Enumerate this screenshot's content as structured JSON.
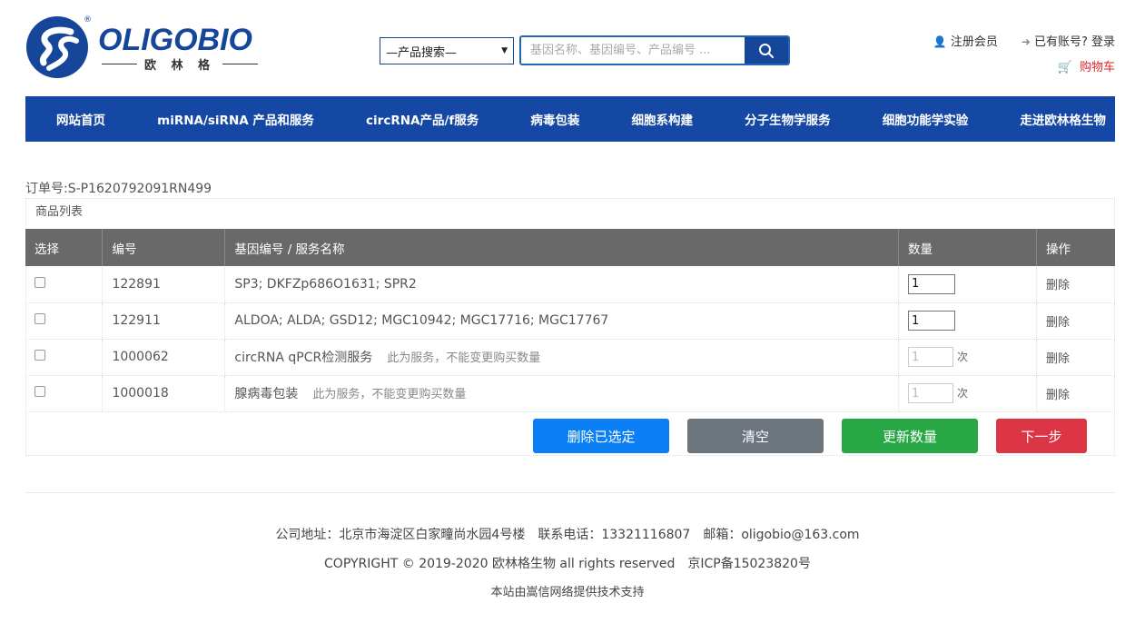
{
  "brand": {
    "name": "OLIGOBIO",
    "reg_mark": "®",
    "subtitle": "欧 林 格",
    "primary_color": "#15469a"
  },
  "search": {
    "category_selected": "—产品搜索—",
    "placeholder": "基因名称、基因编号、产品编号 ...",
    "icon": "search-icon"
  },
  "toplinks": {
    "register": "注册会员",
    "login": "已有账号? 登录",
    "cart": "购物车"
  },
  "nav": {
    "items": [
      "网站首页",
      "miRNA/siRNA 产品和服务",
      "circRNA产品/f服务",
      "病毒包装",
      "细胞系构建",
      "分子生物学服务",
      "细胞功能学实验",
      "走进欧林格生物"
    ]
  },
  "order": {
    "order_no": "订单号:S-P1620792091RN499",
    "list_title": "商品列表",
    "columns": [
      "选择",
      "编号",
      "基因编号 / 服务名称",
      "数量",
      "操作"
    ],
    "rows": [
      {
        "id": "122891",
        "name": "SP3; DKFZp686O1631; SPR2",
        "note": "",
        "qty": "1",
        "unit": "",
        "action": "删除"
      },
      {
        "id": "122911",
        "name": "ALDOA; ALDA; GSD12; MGC10942; MGC17716; MGC17767",
        "note": "",
        "qty": "1",
        "unit": "",
        "action": "删除"
      },
      {
        "id": "1000062",
        "name": "circRNA qPCR检测服务",
        "note": "此为服务，不能变更购买数量",
        "qty": "1",
        "unit": "次",
        "action": "删除"
      },
      {
        "id": "1000018",
        "name": "腺病毒包装",
        "note": "此为服务，不能变更购买数量",
        "qty": "1",
        "unit": "次",
        "action": "删除"
      }
    ],
    "buttons": {
      "delete_selected": "删除已选定",
      "clear": "清空",
      "update_qty": "更新数量",
      "next": "下一步"
    }
  },
  "footer": {
    "line1": "公司地址：北京市海淀区白家疃尚水园4号楼　联系电话：13321116807　邮箱：oligobio@163.com",
    "line2": "COPYRIGHT © 2019-2020 欧林格生物 all rights reserved　京ICP备15023820号",
    "line3": "本站由嵩信网络提供技术支持"
  }
}
